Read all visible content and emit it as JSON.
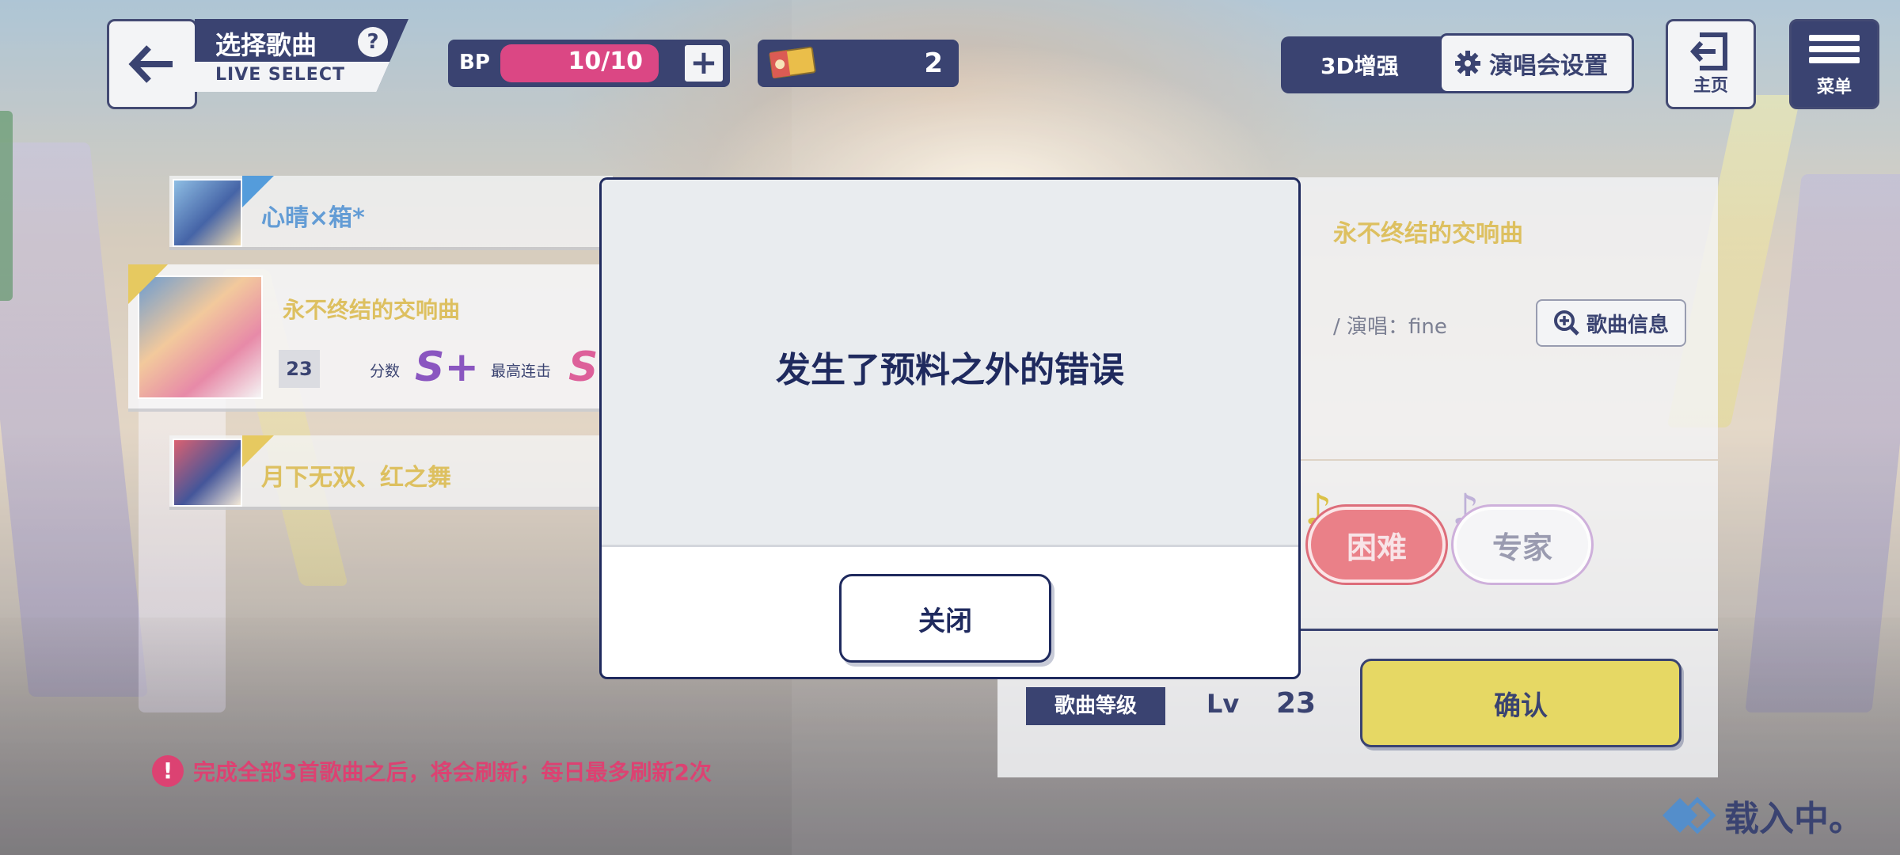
{
  "header": {
    "title_zh": "选择歌曲",
    "title_en": "LIVE SELECT",
    "help": "?",
    "bp_label": "BP",
    "bp_value": "10/10",
    "bp_plus": "+",
    "ticket_count": "2",
    "btn_3d": "3D增强",
    "btn_concert": "演唱会设置",
    "btn_home": "主页",
    "btn_menu": "菜单"
  },
  "songs": [
    {
      "title": "心晴×箱*"
    },
    {
      "title": "永不终结的交响曲",
      "level": "23",
      "score_label": "分数",
      "combo_label": "最高连击",
      "score_rank": "S+",
      "combo_rank": "S"
    },
    {
      "title": "月下无双、红之舞"
    }
  ],
  "notice": "完成全部3首歌曲之后，将会刷新；每日最多刷新2次",
  "detail": {
    "song_name": "永不终结的交响曲",
    "singer": "/ 演唱：fine",
    "info_button": "歌曲信息",
    "difficulty_hard": "困难",
    "difficulty_expert": "专家",
    "level_tag": "歌曲等级",
    "lv_label": "Lv",
    "lv_value": "23",
    "confirm": "确认"
  },
  "loading": "载入中。",
  "modal": {
    "message": "发生了预料之外的错误",
    "close": "关闭"
  },
  "colors": {
    "navy": "#1f2a5e",
    "bp_bar": "#d62e73",
    "gold": "#d9b84b",
    "confirm": "#e3d34f",
    "warning": "#d8285f"
  }
}
